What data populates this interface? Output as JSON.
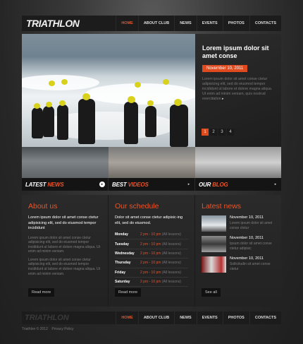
{
  "header": {
    "logo": "TRIATHLON",
    "nav": [
      "HOME",
      "ABOUT CLUB",
      "NEWS",
      "EVENTS",
      "PHOTOS",
      "CONTACTS"
    ]
  },
  "hero": {
    "title": "Lorem ipsum dolor sit amet conse",
    "date": "November 10, 2011",
    "text": "Lorem ipsum dolor sit amet conse ctetur adipisicing elit, sed do eiusmod tempor incididunt ut labore et dolore magna aliqua. Ut enim ad minim veniam, quis nostrud exercitation",
    "more": "▸",
    "pages": [
      "1",
      "2",
      "3",
      "4"
    ]
  },
  "sections": {
    "latest_news": {
      "a": "LATEST ",
      "b": "NEWS"
    },
    "best_videos": {
      "a": "BEST ",
      "b": "VIDEOS"
    },
    "our_blog": {
      "a": "OUR ",
      "b": "BLOG"
    },
    "arrow": "▸"
  },
  "about": {
    "title": "About us",
    "lead": "Lorem ipsum dolor sit amet conse ctetur adipisicing elit, sed do eiusmod tempor incididunt",
    "p1": "Lorem ipsum dolor sit amet conse ctetur adipisicing elit, sed do eiusmod tempor incididunt ut labore et dolore magna aliqua. Ut enim ad minim veniam.",
    "p2": "Lorem ipsum dolor sit amet conse ctetur adipisicing elit, sed do eiusmod tempor incididunt ut labore et dolore magna aliqua. Ut enim ad minim veniam.",
    "button": "Read more"
  },
  "schedule": {
    "title": "Our schedule",
    "lead": "Dolor sit amet conse ctetur adipisic-ing elit, sed do eiusmod.",
    "rows": [
      {
        "day": "Monday",
        "time": "2 pm - 10 pm",
        "note": "(All lessons)"
      },
      {
        "day": "Tuesday",
        "time": "2 pm - 10 pm",
        "note": "(All lessons)"
      },
      {
        "day": "Wednesday",
        "time": "2 pm - 10 pm",
        "note": "(All lessons)"
      },
      {
        "day": "Thursday",
        "time": "2 pm - 10 pm",
        "note": "(All lessons)"
      },
      {
        "day": "Friday",
        "time": "2 pm - 10 pm",
        "note": "(All lessons)"
      },
      {
        "day": "Saturday",
        "time": "2 pm - 10 pm",
        "note": "(All lessons)"
      }
    ],
    "button": "Read more"
  },
  "latest": {
    "title": "Latest news",
    "items": [
      {
        "date": "November 10, 2011",
        "text": "Lorem ipsum dolor sit amet conse ctetur"
      },
      {
        "date": "November 10, 2011",
        "text": "Ipsum dolor sit amet conse ctetur adipisic"
      },
      {
        "date": "November 10, 2011",
        "text": "Sollicitudin sit amet conse ctetur"
      }
    ],
    "button": "See all"
  },
  "footer": {
    "logo": "TRIATHLON",
    "nav": [
      "HOME",
      "ABOUT CLUB",
      "NEWS",
      "EVENTS",
      "PHOTOS",
      "CONTACTS"
    ],
    "copyright": "Triathlon © 2012",
    "privacy": "Privacy Policy"
  },
  "colors": {
    "accent": "#e8542a",
    "background": "#2a2a2a"
  }
}
